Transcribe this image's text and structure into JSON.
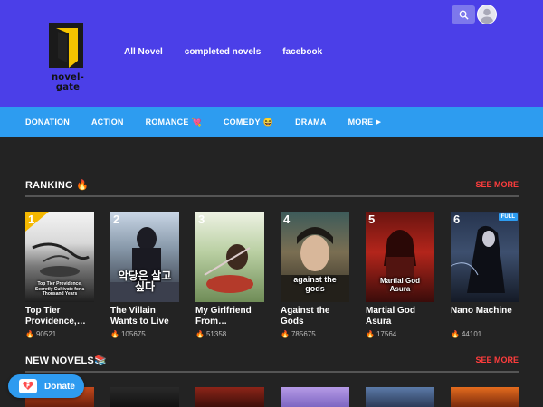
{
  "header": {
    "logo_text": "novel-gate",
    "nav": [
      "All Novel",
      "completed novels",
      "facebook"
    ],
    "colors": {
      "bg": "#4b3fe8",
      "search": "#7d78ec"
    }
  },
  "menubar": {
    "items": [
      {
        "label": "DONATION",
        "emoji": ""
      },
      {
        "label": "ACTION",
        "emoji": ""
      },
      {
        "label": "ROMANCE",
        "emoji": "💘"
      },
      {
        "label": "COMEDY",
        "emoji": "😆"
      },
      {
        "label": "DRAMA",
        "emoji": ""
      },
      {
        "label": "MORE",
        "emoji": "▶"
      }
    ],
    "color": "#2d9cf0"
  },
  "ranking": {
    "title": "RANKING",
    "emoji": "🔥",
    "see_more": "SEE MORE",
    "items": [
      {
        "rank": "1",
        "title": "Top Tier Providence,…",
        "views": "90521",
        "cover_text": "Top Tier Providence, Secretly Cultivate for a Thousand Years",
        "full": ""
      },
      {
        "rank": "2",
        "title": "The Villain Wants to Live",
        "views": "105675",
        "cover_text": "악당은 살고싶다",
        "full": ""
      },
      {
        "rank": "3",
        "title": "My Girlfriend From…",
        "views": "51358",
        "cover_text": "",
        "full": ""
      },
      {
        "rank": "4",
        "title": "Against the Gods",
        "views": "785675",
        "cover_text": "against the gods",
        "full": ""
      },
      {
        "rank": "5",
        "title": "Martial God Asura",
        "views": "17564",
        "cover_text": "Martial God Asura",
        "full": ""
      },
      {
        "rank": "6",
        "title": "Nano Machine",
        "views": "44101",
        "cover_text": "",
        "full": "FULL"
      }
    ]
  },
  "new_novels": {
    "title": "NEW NOVELS",
    "emoji": "📚",
    "see_more": "SEE MORE"
  },
  "donate": {
    "label": "Donate"
  }
}
